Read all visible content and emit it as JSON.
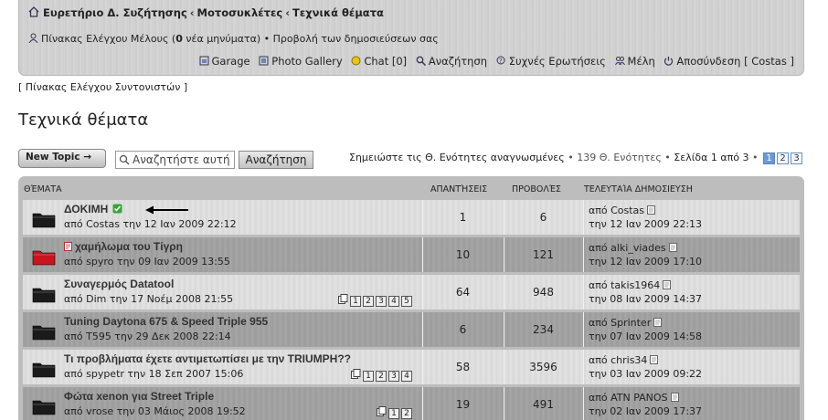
{
  "header": {
    "breadcrumb": [
      {
        "label": "Ευρετήριο Δ. Συζήτησης"
      },
      {
        "label": "Μοτοσυκλέτες"
      },
      {
        "label": "Τεχνικά θέματα"
      }
    ],
    "breadcrumb_sep": "‹",
    "member": {
      "panel_prefix": "Πίνακας Ελέγχου Μέλους (",
      "new_count": "0",
      "panel_suffix": " νέα μηνύματα)",
      "bullet": "•",
      "view_posts": "Προβολή των δημοσιεύσεων σας"
    },
    "links": {
      "garage": "Garage",
      "photo_gallery": "Photo Gallery",
      "chat": "Chat [0]",
      "search": "Αναζήτηση",
      "faq": "Συχνές Ερωτήσεις",
      "members": "Μέλη",
      "logout": "Αποσύνδεση [ Costas ]"
    }
  },
  "mod_cp": "[ Πίνακας Ελέγχου Συντονιστών ]",
  "page_title": "Τεχνικά θέματα",
  "toolbar": {
    "new_topic": "New Topic →",
    "search_placeholder": "Αναζητήστε αυτή",
    "search_button": "Αναζήτηση",
    "mark_read": "Σημειώστε τις Θ. Ενότητες αναγνωσμένες",
    "topic_count": "139 Θ. Ενότητες",
    "page_info": "Σελίδα 1 από 3",
    "bullet": "•",
    "pages": [
      "1",
      "2",
      "3"
    ]
  },
  "table": {
    "headers": {
      "topics": "ΘΈΜΑΤΑ",
      "replies": "ΑΠΑΝΤΉΣΕΙΣ",
      "views": "ΠΡΟΒΟΛΈΣ",
      "last_post": "ΤΕΛΕΥΤΑΊΑ ΔΗΜΟΣΙΕΥΣΗ"
    },
    "rows": [
      {
        "title": "ΔΟΚΙΜΗ",
        "by": "από Costas την 12 Ιαν 2009 22:12",
        "replies": "1",
        "views": "6",
        "last_by": "από Costas",
        "last_date": "την 12 Ιαν 2009 22:13",
        "pages": []
      },
      {
        "title": "χαμήλωμα του Τίγρη",
        "by": "από spyro την 09 Ιαν 2009 13:55",
        "replies": "10",
        "views": "121",
        "last_by": "από alki_viades",
        "last_date": "την 12 Ιαν 2009 17:10",
        "pages": []
      },
      {
        "title": "Συναγερμός Datatool",
        "by": "από Dim την 17 Νοέμ 2008 21:55",
        "replies": "64",
        "views": "948",
        "last_by": "από takis1964",
        "last_date": "την 08 Ιαν 2009 14:37",
        "pages": [
          "1",
          "2",
          "3",
          "4",
          "5"
        ]
      },
      {
        "title": "Tuning Daytona 675 & Speed Triple 955",
        "by": "από T595 την 29 Δεκ 2008 22:14",
        "replies": "6",
        "views": "234",
        "last_by": "από Sprinter",
        "last_date": "την 07 Ιαν 2009 14:58",
        "pages": []
      },
      {
        "title": "Τι προβλήματα έχετε αντιμετωπίσει με την TRIUMPH??",
        "by": "από spypetr την 18 Σεπ 2007 15:06",
        "replies": "58",
        "views": "3596",
        "last_by": "από chris34",
        "last_date": "την 03 Ιαν 2009 09:22",
        "pages": [
          "1",
          "2",
          "3",
          "4"
        ]
      },
      {
        "title": "Φώτα xenon για Street Triple",
        "by": "από vrose την 03 Μάιος 2008 19:52",
        "replies": "19",
        "views": "491",
        "last_by": "από ATN PANOS",
        "last_date": "την 02 Ιαν 2009 17:37",
        "pages": [
          "1",
          "2"
        ]
      }
    ]
  },
  "colors": {
    "folder_normal": "#1a1a1a",
    "folder_hot": "#c8141e",
    "check_green": "#3aa33a",
    "current_page": "#6b9ad3"
  }
}
